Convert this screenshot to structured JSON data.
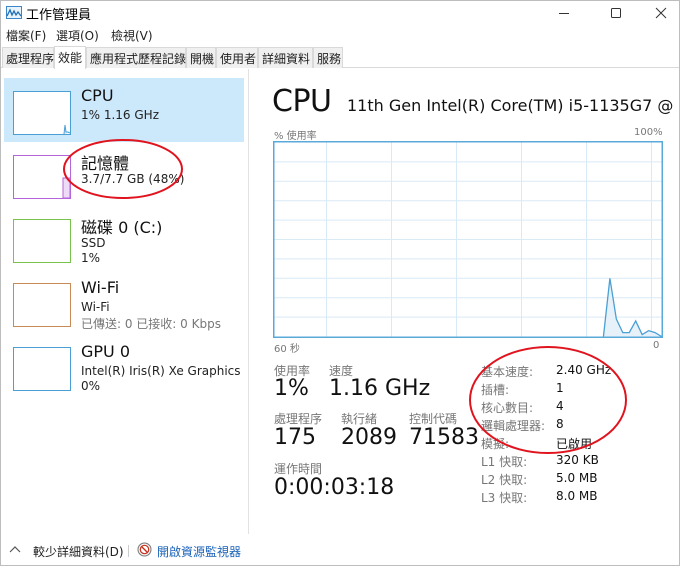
{
  "window": {
    "title": "工作管理員",
    "controls": {
      "minimize": "minimize",
      "maximize": "maximize",
      "close": "close"
    }
  },
  "menu": [
    "檔案(F)",
    "選項(O)",
    "檢視(V)"
  ],
  "tabs": [
    {
      "label": "處理程序",
      "active": false
    },
    {
      "label": "效能",
      "active": true
    },
    {
      "label": "應用程式歷程記錄",
      "active": false
    },
    {
      "label": "開機",
      "active": false
    },
    {
      "label": "使用者",
      "active": false
    },
    {
      "label": "詳細資料",
      "active": false
    },
    {
      "label": "服務",
      "active": false
    }
  ],
  "resources": [
    {
      "name": "CPU",
      "line1": "1% 1.16 GHz",
      "line2": "",
      "color": "#4a9fd5",
      "selected": true
    },
    {
      "name": "記憶體",
      "line1": "3.7/7.7 GB (48%)",
      "line2": "",
      "color": "#b565d9",
      "selected": false
    },
    {
      "name": "磁碟 0 (C:)",
      "line1": "SSD",
      "line2": "1%",
      "color": "#78c34b",
      "selected": false
    },
    {
      "name": "Wi-Fi",
      "line1": "Wi-Fi",
      "line2": "已傳送: 0 已接收: 0 Kbps",
      "color": "#c88b55",
      "selected": false
    },
    {
      "name": "GPU 0",
      "line1": "Intel(R) Iris(R) Xe Graphics",
      "line2": "0%",
      "color": "#4a9fd5",
      "selected": false
    }
  ],
  "main": {
    "title": "CPU",
    "model": "11th Gen Intel(R) Core(TM) i5-1135G7 @ ...",
    "stats": {
      "usage_label": "使用率",
      "usage_value": "1%",
      "speed_label": "速度",
      "speed_value": "1.16 GHz",
      "processes_label": "處理程序",
      "processes_value": "175",
      "threads_label": "執行緒",
      "threads_value": "2089",
      "handles_label": "控制代碼",
      "handles_value": "71583",
      "uptime_label": "運作時間",
      "uptime_value": "0:00:03:18"
    },
    "specs": [
      {
        "label": "基本速度:",
        "value": "2.40 GHz"
      },
      {
        "label": "插槽:",
        "value": "1"
      },
      {
        "label": "核心數目:",
        "value": "4"
      },
      {
        "label": "邏輯處理器:",
        "value": "8"
      },
      {
        "label": "模擬:",
        "value": "已啟用"
      },
      {
        "label": "L1 快取:",
        "value": "320 KB"
      },
      {
        "label": "L2 快取:",
        "value": "5.0 MB"
      },
      {
        "label": "L3 快取:",
        "value": "8.0 MB"
      }
    ]
  },
  "chart_data": {
    "type": "area",
    "title": "% 使用率",
    "ylabel": "% 使用率",
    "y_max_label": "100%",
    "x_left_label": "60 秒",
    "x_right_label": "0",
    "ylim": [
      0,
      100
    ],
    "xlim": [
      60,
      0
    ],
    "grid": true,
    "grid_rows": 10,
    "grid_cols": 6,
    "color": "#4a9fd5",
    "x": [
      9,
      8,
      7,
      6,
      5,
      4,
      3,
      2,
      1,
      0
    ],
    "values": [
      0,
      30,
      9,
      2,
      2,
      8,
      1,
      3,
      2,
      0
    ]
  },
  "footer": {
    "fewer_details": "較少詳細資料(D)",
    "resource_monitor": "開啟資源監視器"
  }
}
